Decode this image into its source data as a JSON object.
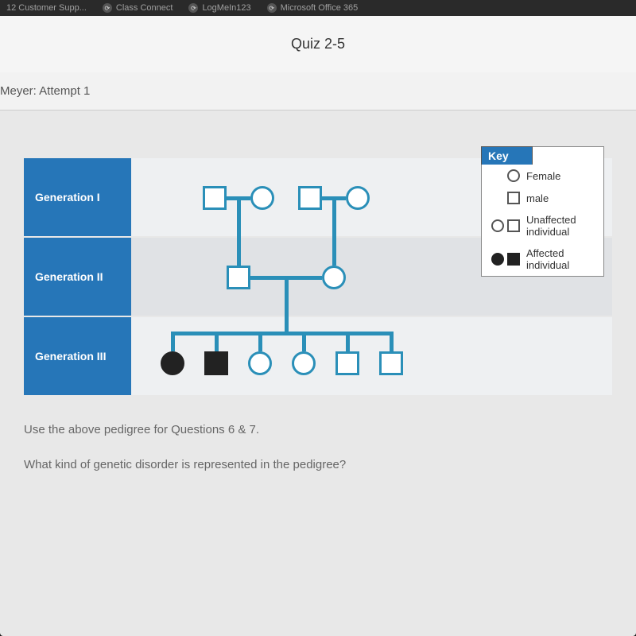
{
  "bookmarks": [
    {
      "label": "12 Customer Supp..."
    },
    {
      "label": "Class Connect"
    },
    {
      "label": "LogMeIn123"
    },
    {
      "label": "Microsoft Office 365"
    }
  ],
  "quiz": {
    "title": "Quiz 2-5",
    "attempt": "Meyer: Attempt 1"
  },
  "generations": {
    "g1": "Generation I",
    "g2": "Generation II",
    "g3": "Generation III"
  },
  "key": {
    "header": "Key",
    "female": "Female",
    "male": "male",
    "unaffected": "Unaffected individual",
    "affected": "Affected individual"
  },
  "questions": {
    "instruction": "Use the above pedigree for Questions 6 & 7.",
    "q": "What kind of genetic disorder is represented in the pedigree?"
  },
  "chart_data": {
    "type": "pedigree",
    "generations": [
      {
        "label": "Generation I",
        "couples": [
          {
            "left": {
              "sex": "male",
              "affected": false
            },
            "right": {
              "sex": "female",
              "affected": false
            }
          },
          {
            "left": {
              "sex": "male",
              "affected": false
            },
            "right": {
              "sex": "female",
              "affected": false
            }
          }
        ]
      },
      {
        "label": "Generation II",
        "couples": [
          {
            "left": {
              "sex": "male",
              "affected": false,
              "parent_couple": 0
            },
            "right": {
              "sex": "female",
              "affected": false,
              "parent_couple": 1
            }
          }
        ]
      },
      {
        "label": "Generation III",
        "individuals": [
          {
            "sex": "female",
            "affected": true
          },
          {
            "sex": "male",
            "affected": true
          },
          {
            "sex": "female",
            "affected": false
          },
          {
            "sex": "female",
            "affected": false
          },
          {
            "sex": "male",
            "affected": false
          },
          {
            "sex": "male",
            "affected": false
          }
        ]
      }
    ]
  }
}
